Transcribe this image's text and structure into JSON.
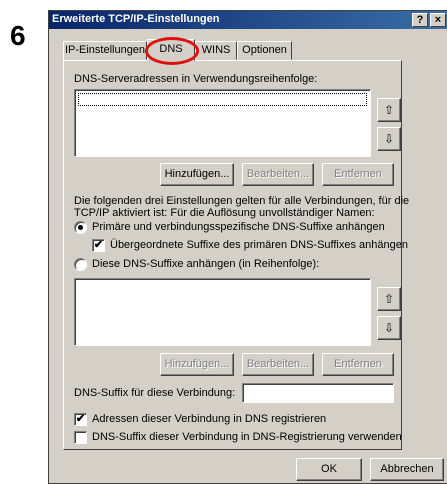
{
  "step_number": "6",
  "window": {
    "title": "Erweiterte TCP/IP-Einstellungen",
    "help_glyph": "?",
    "close_glyph": "×"
  },
  "tabs": [
    {
      "label": "IP-Einstellungen",
      "active": false
    },
    {
      "label": "DNS",
      "active": true
    },
    {
      "label": "WINS",
      "active": false
    },
    {
      "label": "Optionen",
      "active": false
    }
  ],
  "dns_servers": {
    "label": "DNS-Serveradressen in Verwendungsreihenfolge:",
    "items": [],
    "add_label": "Hinzufügen...",
    "edit_label": "Bearbeiten...",
    "remove_label": "Entfernen",
    "up_glyph": "⇧",
    "down_glyph": "⇩"
  },
  "info_text_line1": "Die folgenden drei Einstellungen gelten für alle Verbindungen, für die",
  "info_text_line2": "TCP/IP aktiviert ist: Für die Auflösung unvollständiger Namen:",
  "radio_primary": {
    "label": "Primäre und verbindungsspezifische DNS-Suffixe anhängen",
    "checked": true
  },
  "check_parent_suffix": {
    "label": "Übergeordnete Suffixe des primären DNS-Suffixes anhängen",
    "checked": true
  },
  "radio_append_these": {
    "label": "Diese DNS-Suffixe anhängen (in Reihenfolge):",
    "checked": false
  },
  "suffix_list": {
    "items": [],
    "add_label": "Hinzufügen...",
    "edit_label": "Bearbeiten...",
    "remove_label": "Entfernen",
    "up_glyph": "⇧",
    "down_glyph": "⇩"
  },
  "connection_suffix": {
    "label": "DNS-Suffix für diese Verbindung:",
    "value": ""
  },
  "check_register": {
    "label": "Adressen dieser Verbindung in DNS registrieren",
    "checked": true,
    "glyph": "✔"
  },
  "check_use_suffix": {
    "label": "DNS-Suffix dieser Verbindung in DNS-Registrierung verwenden",
    "checked": false
  },
  "footer": {
    "ok_label": "OK",
    "cancel_label": "Abbrechen"
  },
  "colors": {
    "titlebar_start": "#0a246a",
    "titlebar_end": "#3a6ea5",
    "dialog_bg": "#d4d0c8",
    "highlight_ring": "#e01010"
  }
}
